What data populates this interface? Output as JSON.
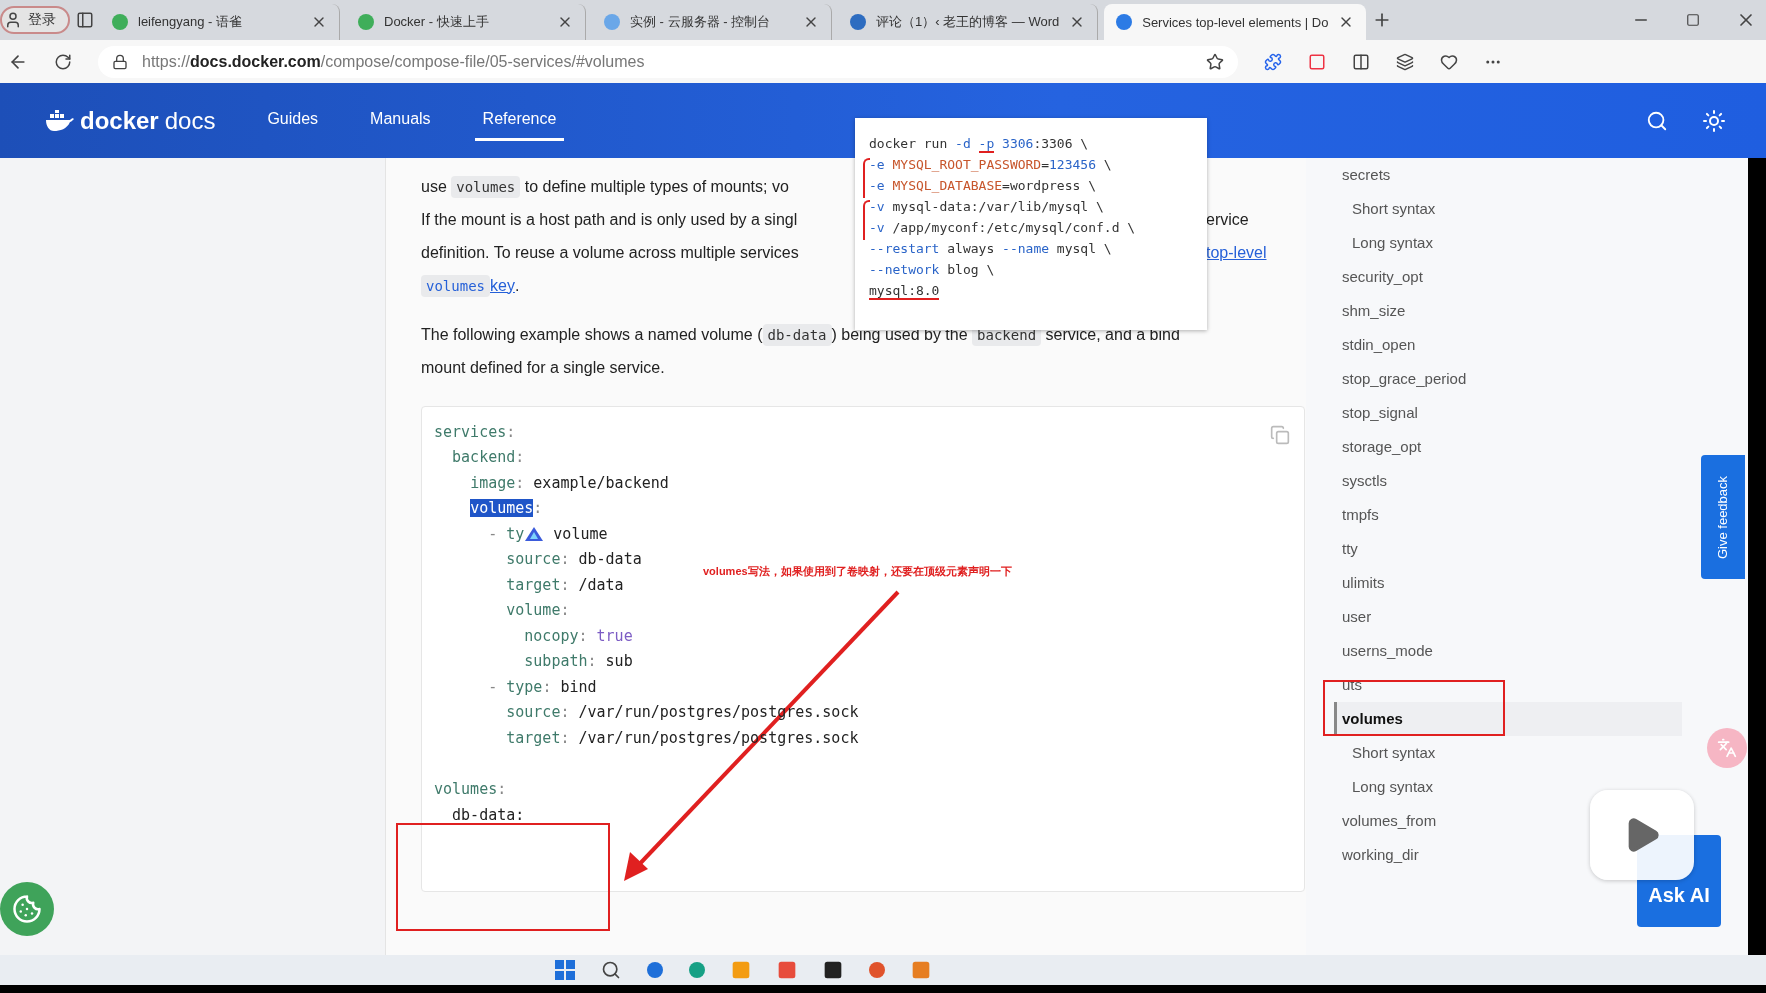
{
  "browser": {
    "profile": "登录",
    "tabs": [
      {
        "label": "leifengyang - 语雀",
        "selected": false
      },
      {
        "label": "Docker - 快速上手",
        "selected": false
      },
      {
        "label": "实例 - 云服务器 - 控制台",
        "selected": false
      },
      {
        "label": "评论（1）‹ 老王的博客 — Word",
        "selected": false
      },
      {
        "label": "Services top-level elements | Do",
        "selected": true
      }
    ],
    "url": "https://**docs.docker.com**/compose/compose-file/05-services/#volumes"
  },
  "header": {
    "brand": "docker",
    "brand_suffix": "docs",
    "nav": [
      {
        "label": "Guides",
        "selected": false
      },
      {
        "label": "Manuals",
        "selected": false
      },
      {
        "label": "Reference",
        "selected": true
      }
    ]
  },
  "article": {
    "lines": [
      {
        "left": [
          {
            "kind": "text",
            "text": "use "
          },
          {
            "kind": "code",
            "text": "volumes"
          },
          {
            "kind": "text",
            "text": " to define multiple types of mounts; vo"
          }
        ]
      },
      {
        "left": [
          {
            "kind": "text",
            "text": "If the mount is a host path and is only used by a singl"
          }
        ],
        "right": [
          {
            "kind": "text",
            "text": "ervice"
          }
        ]
      },
      {
        "left": [
          {
            "kind": "text",
            "text": "definition. To reuse a volume across multiple services"
          }
        ],
        "right": [
          {
            "kind": "link",
            "text": "top-level"
          }
        ]
      },
      {
        "left": [
          {
            "kind": "codelink",
            "text": "volumes"
          },
          {
            "kind": "link",
            "text": " key"
          },
          {
            "kind": "text",
            "text": "."
          }
        ]
      }
    ],
    "paragraph": [
      {
        "parts": [
          {
            "kind": "text",
            "text": "The following example shows a named volume ("
          },
          {
            "kind": "code",
            "text": "db-data"
          },
          {
            "kind": "text",
            "text": ") being used by the "
          },
          {
            "kind": "code",
            "text": "backend"
          },
          {
            "kind": "text",
            "text": " service, and a bind"
          }
        ]
      },
      {
        "parts": [
          {
            "kind": "text",
            "text": "mount defined for a single service."
          }
        ]
      }
    ],
    "code_blocks": [
      [
        {
          "parts": [
            {
              "kind": "key",
              "text": "services"
            },
            {
              "kind": "punct",
              "text": ":"
            }
          ]
        },
        {
          "parts": [
            {
              "kind": "key",
              "text": "  backend"
            },
            {
              "kind": "punct",
              "text": ":"
            }
          ]
        },
        {
          "parts": [
            {
              "kind": "key",
              "text": "    image"
            },
            {
              "kind": "punct",
              "text": ": "
            },
            {
              "kind": "value",
              "text": "example/backend"
            }
          ]
        },
        {
          "parts": [
            {
              "kind": "selected",
              "text": "    volumes"
            },
            {
              "kind": "punct",
              "text": ":"
            }
          ]
        },
        {
          "parts": [
            {
              "kind": "punct",
              "text": "      - "
            },
            {
              "kind": "key",
              "text": "ty"
            },
            {
              "kind": "icon"
            },
            {
              "kind": "value",
              "text": " volume"
            }
          ]
        },
        {
          "parts": [
            {
              "kind": "key",
              "text": "        source"
            },
            {
              "kind": "punct",
              "text": ": "
            },
            {
              "kind": "value",
              "text": "db-data"
            }
          ]
        },
        {
          "parts": [
            {
              "kind": "key",
              "text": "        target"
            },
            {
              "kind": "punct",
              "text": ": "
            },
            {
              "kind": "value",
              "text": "/data"
            }
          ]
        },
        {
          "parts": [
            {
              "kind": "key",
              "text": "        volume"
            },
            {
              "kind": "punct",
              "text": ":"
            }
          ]
        },
        {
          "parts": [
            {
              "kind": "key",
              "text": "          nocopy"
            },
            {
              "kind": "punct",
              "text": ": "
            },
            {
              "kind": "bool",
              "text": "true"
            }
          ]
        },
        {
          "parts": [
            {
              "kind": "key",
              "text": "          subpath"
            },
            {
              "kind": "punct",
              "text": ": "
            },
            {
              "kind": "value",
              "text": "sub"
            }
          ]
        },
        {
          "parts": [
            {
              "kind": "punct",
              "text": "      - "
            },
            {
              "kind": "key",
              "text": "type"
            },
            {
              "kind": "punct",
              "text": ": "
            },
            {
              "kind": "value",
              "text": "bind"
            }
          ]
        },
        {
          "parts": [
            {
              "kind": "key",
              "text": "        source"
            },
            {
              "kind": "punct",
              "text": ": "
            },
            {
              "kind": "value",
              "text": "/var/run/postgres/postgres.sock"
            }
          ]
        },
        {
          "parts": [
            {
              "kind": "key",
              "text": "        target"
            },
            {
              "kind": "punct",
              "text": ": "
            },
            {
              "kind": "value",
              "text": "/var/run/postgres/postgres.sock"
            }
          ]
        }
      ],
      [
        {
          "parts": [
            {
              "kind": "key",
              "text": "volumes"
            },
            {
              "kind": "punct",
              "text": ":"
            }
          ]
        },
        {
          "parts": [
            {
              "kind": "value",
              "text": "  db-data:"
            }
          ]
        }
      ]
    ]
  },
  "popup": {
    "lines": [
      {
        "bracket": false,
        "parts": [
          {
            "kind": "plain",
            "text": "docker run "
          },
          {
            "kind": "flag",
            "text": "-d "
          },
          {
            "kind": "flag",
            "text": "-p",
            "underline": true
          },
          {
            "kind": "flag",
            "text": " 3306"
          },
          {
            "kind": "plain",
            "text": ":3306 \\"
          }
        ]
      },
      {
        "bracket": true,
        "parts": [
          {
            "kind": "flag",
            "text": "-e "
          },
          {
            "kind": "env",
            "text": "MYSQL_ROOT_PASSWORD"
          },
          {
            "kind": "plain",
            "text": "="
          },
          {
            "kind": "flag",
            "text": "123456"
          },
          {
            "kind": "plain",
            "text": " \\"
          }
        ]
      },
      {
        "bracket": false,
        "parts": [
          {
            "kind": "flag",
            "text": "-e "
          },
          {
            "kind": "env",
            "text": "MYSQL_DATABASE"
          },
          {
            "kind": "plain",
            "text": "=wordpress \\"
          }
        ]
      },
      {
        "bracket": true,
        "parts": [
          {
            "kind": "flag",
            "text": "-v "
          },
          {
            "kind": "plain",
            "text": "mysql-data:/var/lib/mysql \\"
          }
        ]
      },
      {
        "bracket": false,
        "parts": [
          {
            "kind": "flag",
            "text": "-v "
          },
          {
            "kind": "plain",
            "text": "/app/myconf:/etc/mysql/conf.d \\"
          }
        ]
      },
      {
        "bracket": false,
        "parts": [
          {
            "kind": "flag",
            "text": "--restart"
          },
          {
            "kind": "plain",
            "text": " always "
          },
          {
            "kind": "flag",
            "text": "--name"
          },
          {
            "kind": "plain",
            "text": " mysql \\"
          }
        ]
      },
      {
        "bracket": false,
        "parts": [
          {
            "kind": "flag",
            "text": "--network"
          },
          {
            "kind": "plain",
            "text": " blog \\"
          }
        ]
      },
      {
        "bracket": false,
        "parts": [
          {
            "kind": "plain",
            "text": "mysql:8.0",
            "underline": true
          }
        ]
      }
    ]
  },
  "annotation": "volumes写法，如果使用到了卷映射，还要在顶级元素声明一下",
  "toc": [
    {
      "label": "secrets",
      "selected": false,
      "children": [
        {
          "label": "Short syntax",
          "selected": false
        },
        {
          "label": "Long syntax",
          "selected": false
        }
      ]
    },
    {
      "label": "security_opt",
      "selected": false
    },
    {
      "label": "shm_size",
      "selected": false
    },
    {
      "label": "stdin_open",
      "selected": false
    },
    {
      "label": "stop_grace_period",
      "selected": false
    },
    {
      "label": "stop_signal",
      "selected": false
    },
    {
      "label": "storage_opt",
      "selected": false
    },
    {
      "label": "sysctls",
      "selected": false
    },
    {
      "label": "tmpfs",
      "selected": false
    },
    {
      "label": "tty",
      "selected": false
    },
    {
      "label": "ulimits",
      "selected": false
    },
    {
      "label": "user",
      "selected": false
    },
    {
      "label": "userns_mode",
      "selected": false
    },
    {
      "label": "uts",
      "selected": false
    },
    {
      "label": "volumes",
      "selected": true,
      "children": [
        {
          "label": "Short syntax",
          "selected": false
        },
        {
          "label": "Long syntax",
          "selected": false
        }
      ]
    },
    {
      "label": "volumes_from",
      "selected": false
    },
    {
      "label": "working_dir",
      "selected": false
    }
  ],
  "feedback": "Give feedback",
  "ask_ai": "Ask AI"
}
